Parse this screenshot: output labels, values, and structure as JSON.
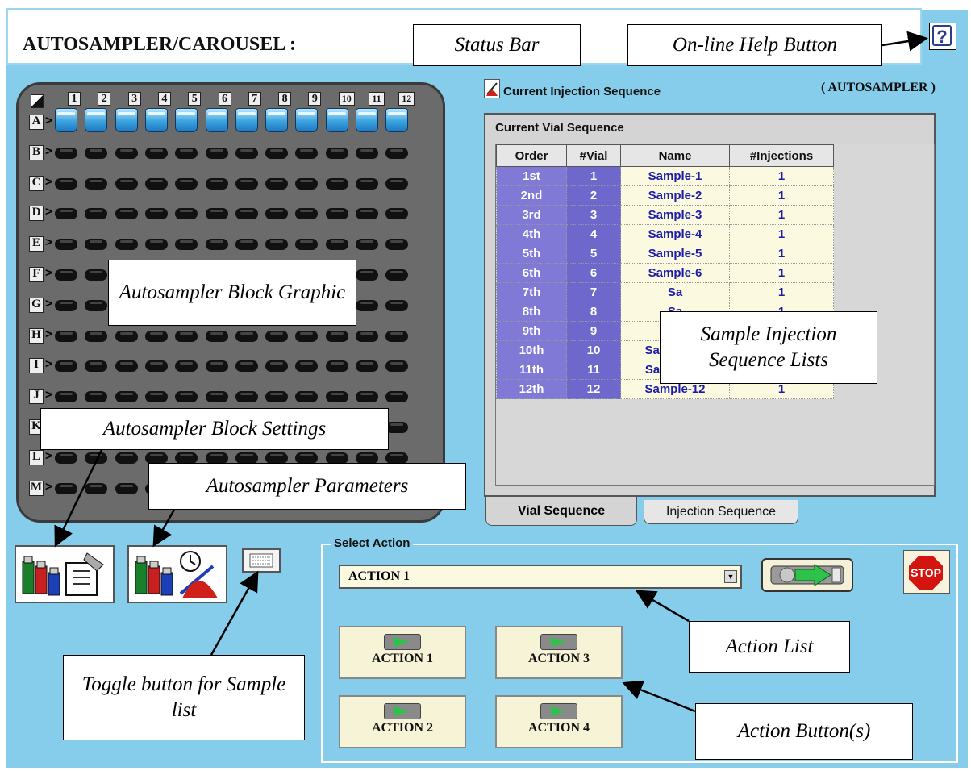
{
  "app": {
    "title": "AUTOSAMPLER/CAROUSEL :",
    "help_label": "?"
  },
  "callouts": {
    "status_bar": "Status Bar",
    "help": "On-line Help Button",
    "block_graphic": "Autosampler Block Graphic",
    "block_settings": "Autosampler Block Settings",
    "parameters": "Autosampler Parameters",
    "toggle": "Toggle button for Sample list",
    "sequence_lists": "Sample Injection Sequence Lists",
    "action_list": "Action List",
    "action_buttons": "Action Button(s)"
  },
  "block": {
    "columns": [
      "1",
      "2",
      "3",
      "4",
      "5",
      "6",
      "7",
      "8",
      "9",
      "10",
      "11",
      "12"
    ],
    "rows": [
      "A",
      "B",
      "C",
      "D",
      "E",
      "F",
      "G",
      "H",
      "I",
      "J",
      "K",
      "L",
      "M"
    ],
    "filled_row": "A"
  },
  "sequence": {
    "title": "Current Injection Sequence",
    "mode": "( AUTOSAMPLER )",
    "panel_label": "Current Vial Sequence",
    "headers": [
      "Order",
      "#Vial",
      "Name",
      "#Injections"
    ],
    "rows": [
      [
        "1st",
        "1",
        "Sample-1",
        "1"
      ],
      [
        "2nd",
        "2",
        "Sample-2",
        "1"
      ],
      [
        "3rd",
        "3",
        "Sample-3",
        "1"
      ],
      [
        "4th",
        "4",
        "Sample-4",
        "1"
      ],
      [
        "5th",
        "5",
        "Sample-5",
        "1"
      ],
      [
        "6th",
        "6",
        "Sample-6",
        "1"
      ],
      [
        "7th",
        "7",
        "Sa",
        "1"
      ],
      [
        "8th",
        "8",
        "Sa",
        "1"
      ],
      [
        "9th",
        "9",
        "Sa",
        "1"
      ],
      [
        "10th",
        "10",
        "Sample-10",
        "1"
      ],
      [
        "11th",
        "11",
        "Sample-11",
        "1"
      ],
      [
        "12th",
        "12",
        "Sample-12",
        "1"
      ]
    ],
    "tabs": [
      "Vial Sequence",
      "Injection Sequence"
    ]
  },
  "actions": {
    "group_label": "Select Action",
    "selected": "ACTION 1",
    "buttons": [
      "ACTION 1",
      "ACTION 2",
      "ACTION 3",
      "ACTION 4"
    ],
    "stop_label": "STOP"
  },
  "colors": {
    "background": "#86cdec",
    "order_cell": "#8079d6",
    "name_cell": "#fbf9e0",
    "name_text": "#1b1ba8"
  }
}
